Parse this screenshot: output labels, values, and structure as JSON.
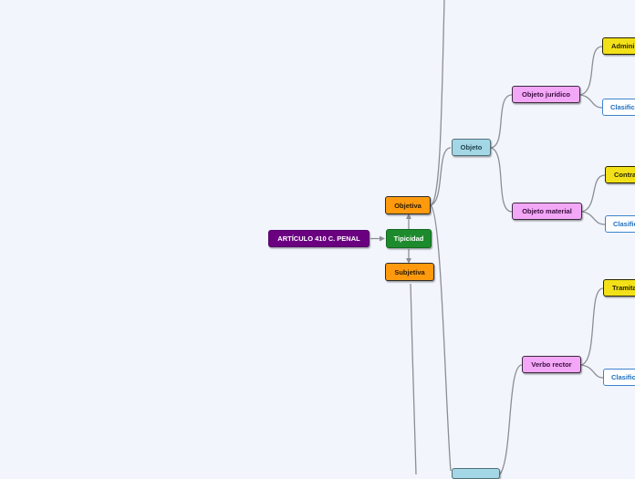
{
  "root": {
    "label": "ARTÍCULO 410 C. PENAL"
  },
  "main": {
    "label": "Tipicidad"
  },
  "objetiva": {
    "label": "Objetiva"
  },
  "subjetiva": {
    "label": "Subjetiva"
  },
  "objeto": {
    "label": "Objeto"
  },
  "objeto_juridico": {
    "label": "Objeto jurídico"
  },
  "objeto_material": {
    "label": "Objeto material"
  },
  "verbo_rector": {
    "label": "Verbo rector"
  },
  "leaves": {
    "admini": "Admini",
    "clasific_1": "Clasific",
    "contra": "Contra",
    "clasific_2": "Clasific",
    "tramita": "Tramita",
    "clasific_3": "Clasific"
  },
  "colors": {
    "background": "#f3f5fd",
    "root": "#6a0080",
    "main": "#1e8a2e",
    "level1": "#ff9a0e",
    "level2": "#a3d7e6",
    "level3": "#f2a7f7",
    "leaf": "#f2e118",
    "leaf_outline": "#3d84cc",
    "connector": "#8c8e96"
  }
}
